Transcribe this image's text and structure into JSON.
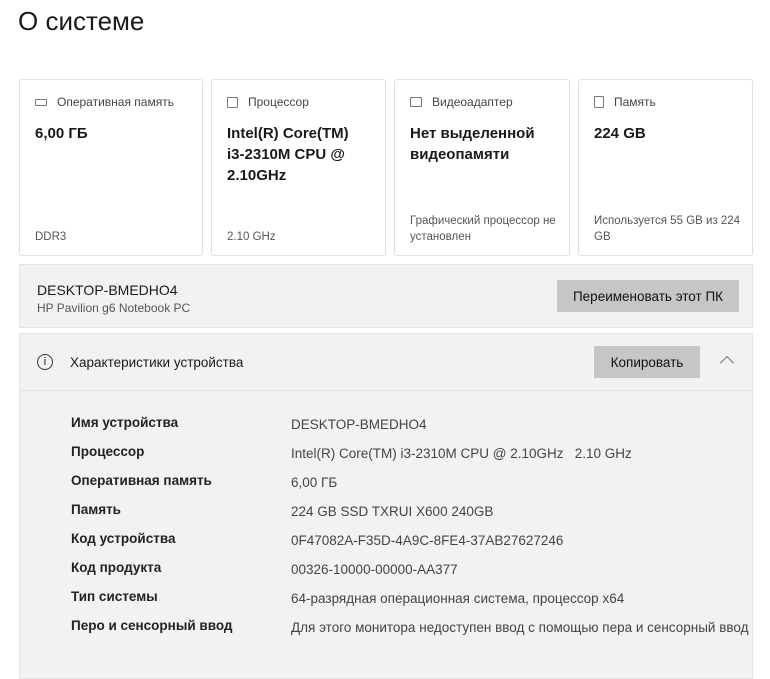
{
  "title": "О системе",
  "cards": [
    {
      "label": "Оперативная память",
      "icon": "ram-icon",
      "value": "6,00 ГБ",
      "sub": "DDR3"
    },
    {
      "label": "Процессор",
      "icon": "cpu-icon",
      "value": "Intel(R) Core(TM) i3-2310M CPU @ 2.10GHz",
      "sub": "2.10 GHz"
    },
    {
      "label": "Видеоадаптер",
      "icon": "gpu-icon",
      "value": "Нет выделенной видеопамяти",
      "sub": "Графический процессор не установлен"
    },
    {
      "label": "Память",
      "icon": "storage-icon",
      "value": "224 GB",
      "sub": "Используется 55 GB из 224 GB"
    }
  ],
  "device": {
    "name": "DESKTOP-BMEDHO4",
    "model": "HP Pavilion g6 Notebook PC",
    "rename_label": "Переименовать этот ПК"
  },
  "specs": {
    "title": "Характеристики устройства",
    "copy_label": "Копировать",
    "rows": [
      {
        "k": "Имя устройства",
        "v": "DESKTOP-BMEDHO4"
      },
      {
        "k": "Процессор",
        "v": "Intel(R) Core(TM) i3-2310M CPU @ 2.10GHz   2.10 GHz"
      },
      {
        "k": "Оперативная память",
        "v": "6,00 ГБ"
      },
      {
        "k": "Память",
        "v": "224 GB SSD TXRUI X600 240GB"
      },
      {
        "k": "Код устройства",
        "v": "0F47082A-F35D-4A9C-8FE4-37AB27627246"
      },
      {
        "k": "Код продукта",
        "v": "00326-10000-00000-AA377"
      },
      {
        "k": "Тип системы",
        "v": "64-разрядная операционная система, процессор x64"
      },
      {
        "k": "Перо и сенсорный ввод",
        "v": "Для этого монитора недоступен ввод с помощью пера и сенсорный ввод"
      }
    ]
  }
}
